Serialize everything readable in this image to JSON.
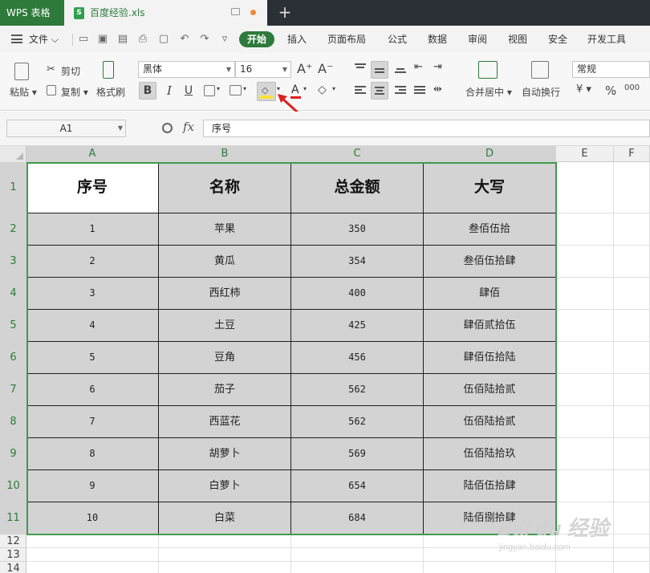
{
  "titlebar": {
    "app_name": "WPS 表格",
    "doc_tab": "百度经验.xls",
    "new_tab": "+"
  },
  "menubar": {
    "file_menu": "文件",
    "tabs": [
      "开始",
      "插入",
      "页面布局",
      "公式",
      "数据",
      "审阅",
      "视图",
      "安全",
      "开发工具"
    ],
    "active_tab": "开始"
  },
  "toolbar": {
    "paste": "粘贴",
    "cut": "剪切",
    "copy": "复制",
    "format_painter": "格式刷",
    "font_name": "黑体",
    "font_size": "16",
    "bold": "B",
    "italic": "I",
    "underline": "U",
    "font_color_glyph": "A",
    "grow_font": "A⁺",
    "shrink_font": "A⁻",
    "merge_center": "合并居中",
    "wrap_text": "自动换行",
    "number_format": "常规",
    "percent": "%",
    "currency": "¥"
  },
  "formula_bar": {
    "cell_ref": "A1",
    "fx": "fx",
    "content": "序号"
  },
  "sheet": {
    "columns": [
      "A",
      "B",
      "C",
      "D",
      "E",
      "F"
    ],
    "rows": [
      "1",
      "2",
      "3",
      "4",
      "5",
      "6",
      "7",
      "8",
      "9",
      "10",
      "11",
      "12",
      "13",
      "14"
    ],
    "table_headers": [
      "序号",
      "名称",
      "总金额",
      "大写"
    ],
    "table_rows": [
      [
        "1",
        "苹果",
        "350",
        "叁佰伍拾"
      ],
      [
        "2",
        "黄瓜",
        "354",
        "叁佰伍拾肆"
      ],
      [
        "3",
        "西红柿",
        "400",
        "肆佰"
      ],
      [
        "4",
        "土豆",
        "425",
        "肆佰贰拾伍"
      ],
      [
        "5",
        "豆角",
        "456",
        "肆佰伍拾陆"
      ],
      [
        "6",
        "茄子",
        "562",
        "伍佰陆拾贰"
      ],
      [
        "7",
        "西蓝花",
        "562",
        "伍佰陆拾贰"
      ],
      [
        "8",
        "胡萝卜",
        "569",
        "伍佰陆拾玖"
      ],
      [
        "9",
        "白萝卜",
        "654",
        "陆佰伍拾肆"
      ],
      [
        "10",
        "白菜",
        "684",
        "陆佰捌拾肆"
      ]
    ]
  },
  "watermark": {
    "main": "Bai du 经验",
    "sub": "jingyan.baidu.com"
  },
  "colors": {
    "accent": "#2d7a3b",
    "selection": "#3f9a4f",
    "cell_fill": "#d3d3d3",
    "arrow": "#e02020",
    "fill_color_swatch": "#f7e43a"
  }
}
